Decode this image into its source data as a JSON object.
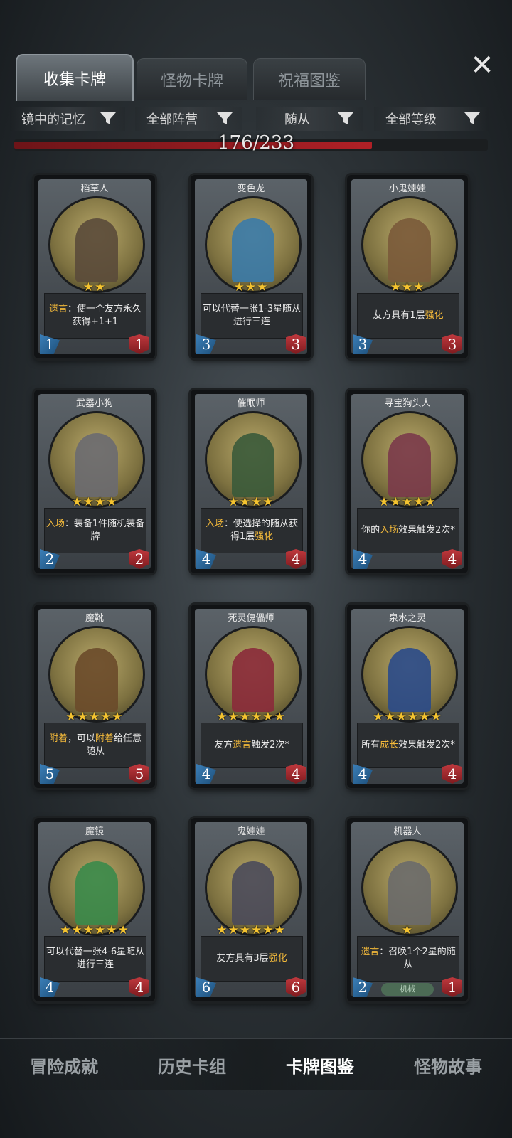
{
  "tabs": [
    {
      "label": "收集卡牌",
      "active": true
    },
    {
      "label": "怪物卡牌",
      "active": false
    },
    {
      "label": "祝福图鉴",
      "active": false
    }
  ],
  "close_icon": "close-icon",
  "filters": [
    {
      "label": "镜中的记忆"
    },
    {
      "label": "全部阵营"
    },
    {
      "label": "随从"
    },
    {
      "label": "全部等级"
    }
  ],
  "progress": {
    "text": "176/233",
    "fraction": 0.755
  },
  "cards": [
    {
      "name": "稻草人",
      "stars": "★★",
      "desc_parts": [
        {
          "t": "遗言",
          "hl": true
        },
        {
          "t": "：使一个友方永久获得+1+1",
          "hl": false
        }
      ],
      "attack": "1",
      "health": "1",
      "portrait": "#5a4a3a"
    },
    {
      "name": "变色龙",
      "stars": "★★★",
      "desc_parts": [
        {
          "t": "可以代替一张1-3星随从进行三连",
          "hl": false
        }
      ],
      "attack": "3",
      "health": "3",
      "portrait": "#3a7aa8"
    },
    {
      "name": "小鬼娃娃",
      "stars": "★★★",
      "desc_parts": [
        {
          "t": "友方具有1层",
          "hl": false
        },
        {
          "t": "强化",
          "hl": true
        }
      ],
      "attack": "3",
      "health": "3",
      "portrait": "#7a5a3a"
    },
    {
      "name": "武器小狗",
      "stars": "★★★★",
      "desc_parts": [
        {
          "t": "入场",
          "hl": true
        },
        {
          "t": "：装备1件随机装备牌",
          "hl": false
        }
      ],
      "attack": "2",
      "health": "2",
      "portrait": "#6a6a70"
    },
    {
      "name": "催眠师",
      "stars": "★★★★",
      "desc_parts": [
        {
          "t": "入场",
          "hl": true
        },
        {
          "t": "：使选择的随从获得1层",
          "hl": false
        },
        {
          "t": "强化",
          "hl": true
        }
      ],
      "attack": "4",
      "health": "4",
      "portrait": "#3a5a3a"
    },
    {
      "name": "寻宝狗头人",
      "stars": "★★★★★",
      "desc_parts": [
        {
          "t": "你的",
          "hl": false
        },
        {
          "t": "入场",
          "hl": true
        },
        {
          "t": "效果触发2次*",
          "hl": false
        }
      ],
      "attack": "4",
      "health": "4",
      "portrait": "#7a3a4a"
    },
    {
      "name": "魔靴",
      "stars": "★★★★★",
      "desc_parts": [
        {
          "t": "附着",
          "hl": true
        },
        {
          "t": "，可以",
          "hl": false
        },
        {
          "t": "附着",
          "hl": true
        },
        {
          "t": "给任意随从",
          "hl": false
        }
      ],
      "attack": "5",
      "health": "5",
      "portrait": "#6a4a2a"
    },
    {
      "name": "死灵傀儡师",
      "stars": "★★★★★★",
      "desc_parts": [
        {
          "t": "友方",
          "hl": false
        },
        {
          "t": "遗言",
          "hl": true
        },
        {
          "t": "触发2次*",
          "hl": false
        }
      ],
      "attack": "4",
      "health": "4",
      "portrait": "#8a2a3a"
    },
    {
      "name": "泉水之灵",
      "stars": "★★★★★★",
      "desc_parts": [
        {
          "t": "所有",
          "hl": false
        },
        {
          "t": "成长",
          "hl": true
        },
        {
          "t": "效果触发2次*",
          "hl": false
        }
      ],
      "attack": "4",
      "health": "4",
      "portrait": "#2a4a8a"
    },
    {
      "name": "魔镜",
      "stars": "★★★★★★",
      "desc_parts": [
        {
          "t": "可以代替一张4-6星随从进行三连",
          "hl": false
        }
      ],
      "attack": "4",
      "health": "4",
      "portrait": "#3a8a4a"
    },
    {
      "name": "鬼娃娃",
      "stars": "★★★★★★",
      "desc_parts": [
        {
          "t": "友方具有3层",
          "hl": false
        },
        {
          "t": "强化",
          "hl": true
        }
      ],
      "attack": "6",
      "health": "6",
      "portrait": "#4a4a5a"
    },
    {
      "name": "机器人",
      "stars": "★",
      "desc_parts": [
        {
          "t": "遗言",
          "hl": true
        },
        {
          "t": "：召唤1个2星的随从",
          "hl": false
        }
      ],
      "attack": "2",
      "health": "1",
      "tag": "机械",
      "portrait": "#6a6a6a"
    }
  ],
  "bottom_nav": [
    {
      "label": "冒险成就",
      "active": false
    },
    {
      "label": "历史卡组",
      "active": false
    },
    {
      "label": "卡牌图鉴",
      "active": true
    },
    {
      "label": "怪物故事",
      "active": false
    }
  ]
}
